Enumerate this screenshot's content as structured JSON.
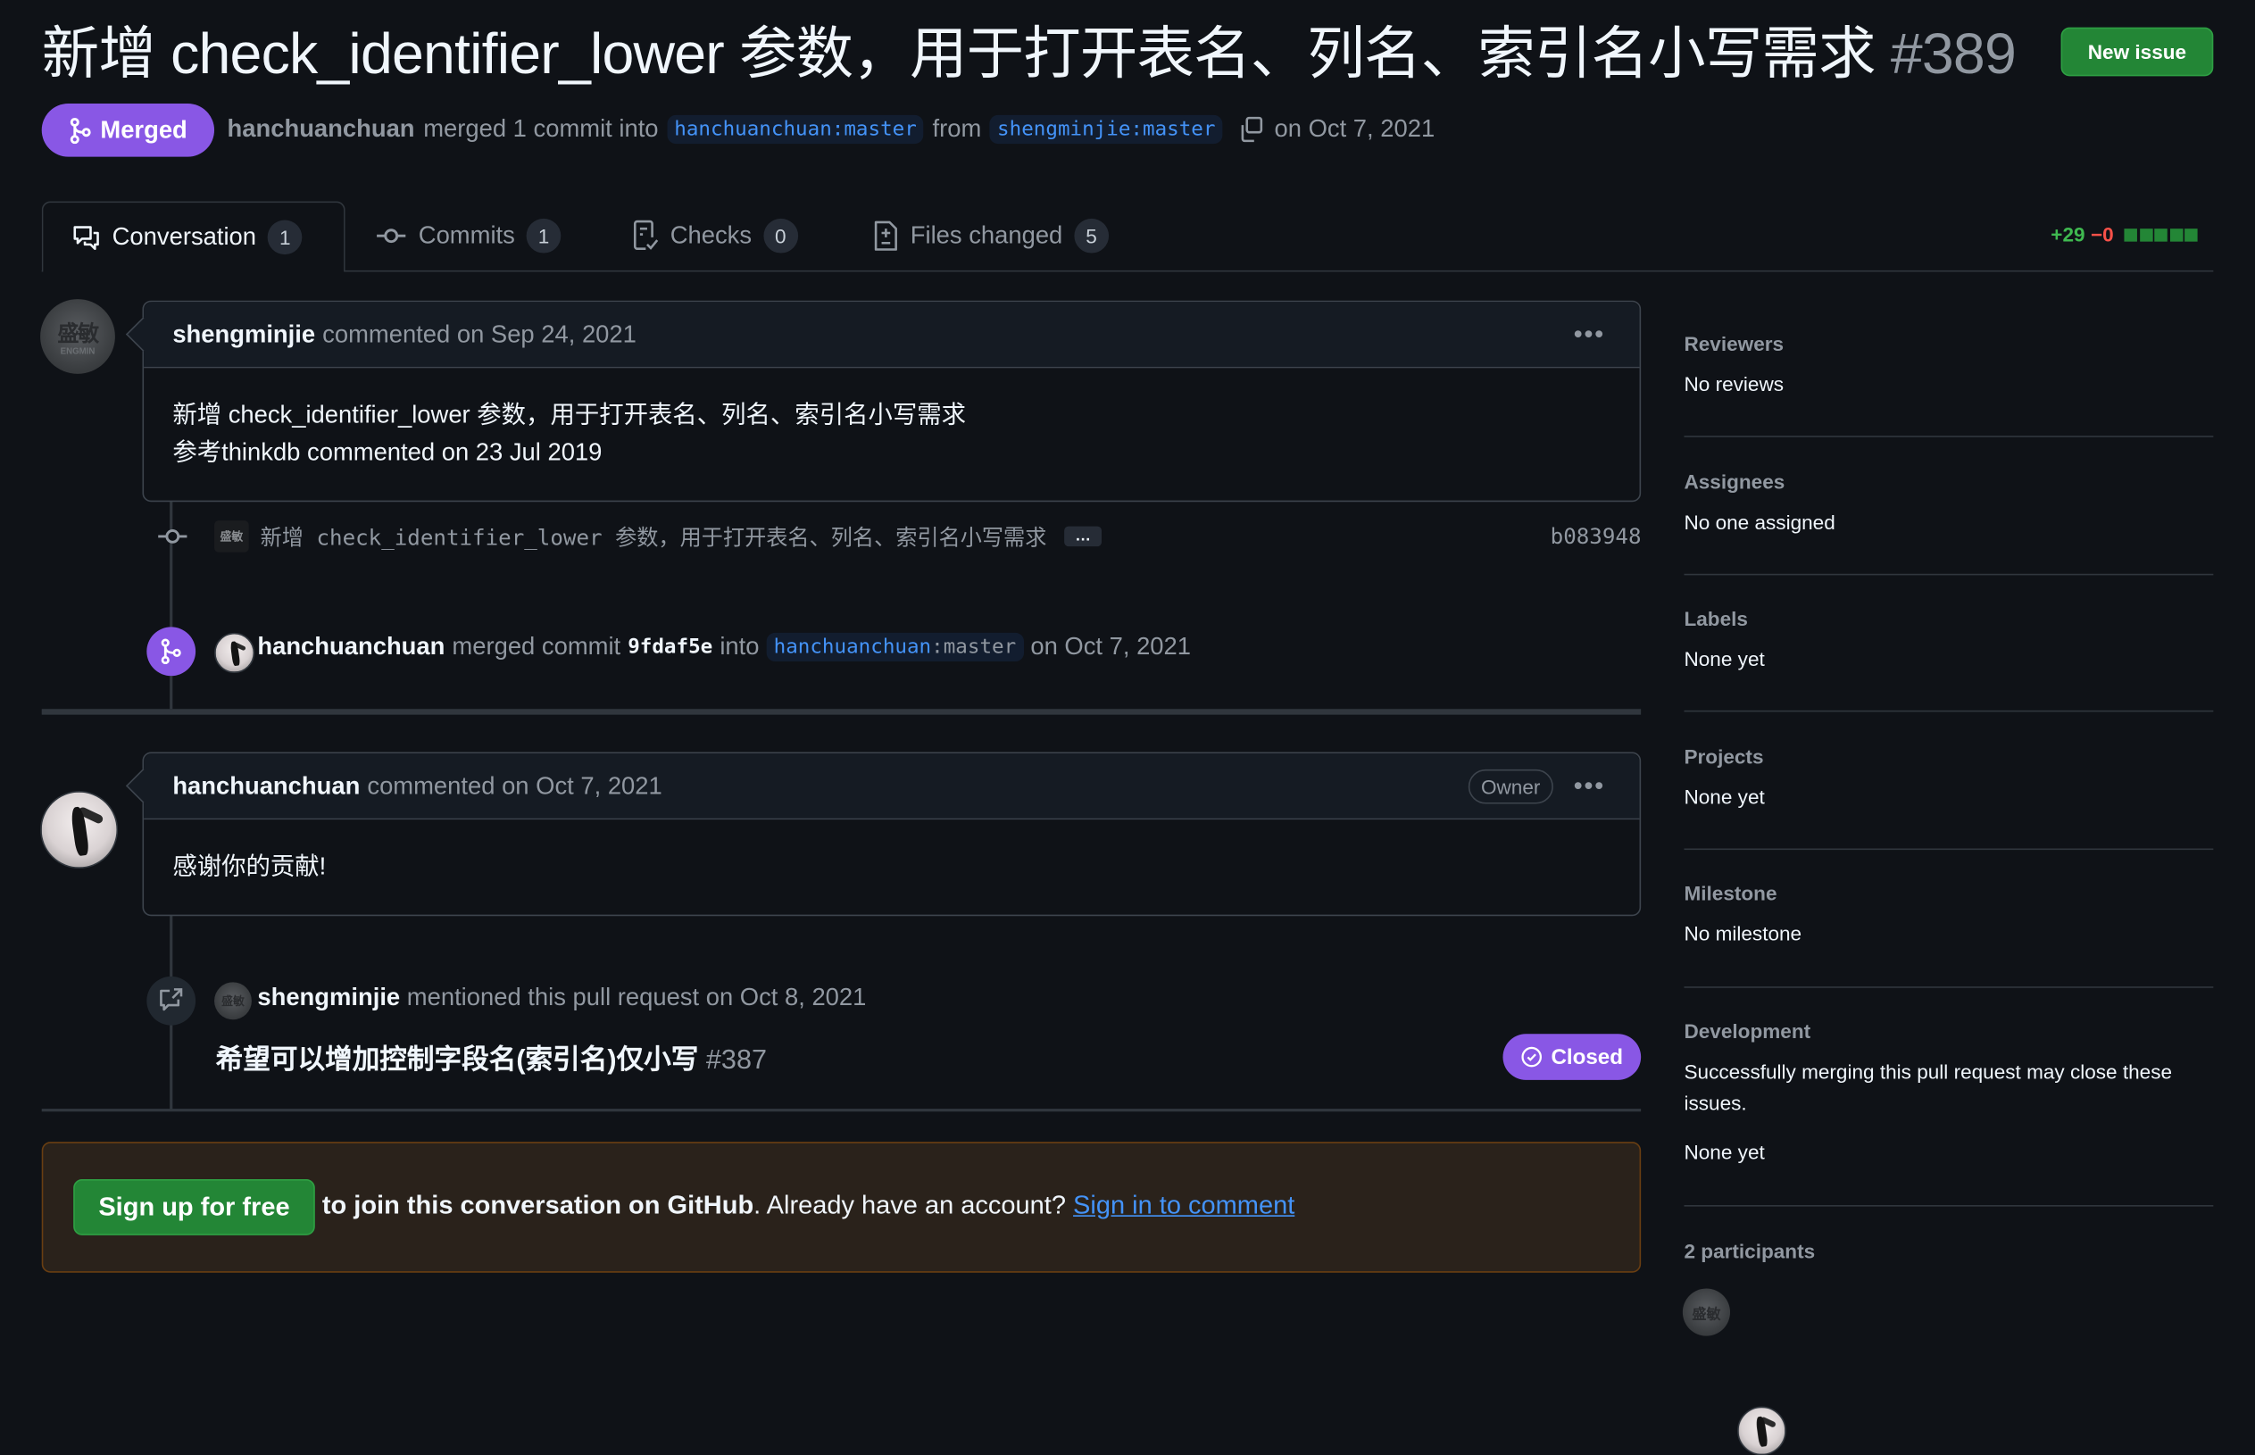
{
  "header": {
    "title": "新增 check_identifier_lower 参数，用于打开表名、列名、索引名小写需求",
    "number": "#389",
    "new_issue_label": "New issue",
    "state": "Merged",
    "meta": {
      "author": "hanchuanchuan",
      "action": "merged 1 commit into",
      "base_branch": "hanchuanchuan:master",
      "from_word": "from",
      "head_branch": "shengminjie:master",
      "date": "on Oct 7, 2021"
    }
  },
  "tabs": [
    {
      "label": "Conversation",
      "count": "1",
      "icon": "comment-discussion-icon",
      "active": true
    },
    {
      "label": "Commits",
      "count": "1",
      "icon": "git-commit-icon"
    },
    {
      "label": "Checks",
      "count": "0",
      "icon": "checklist-icon"
    },
    {
      "label": "Files changed",
      "count": "5",
      "icon": "file-diff-icon"
    }
  ],
  "diffstat": {
    "additions": "+29",
    "deletions": "−0",
    "blocks": 5,
    "colors": {
      "add": "#3fb950",
      "del": "#f85149",
      "block": "#238636"
    }
  },
  "timeline": {
    "comment1": {
      "author": "shengminjie",
      "meta": "commented on Sep 24, 2021",
      "body_line1": "新增 check_identifier_lower 参数，用于打开表名、列名、索引名小写需求",
      "body_line2": "参考thinkdb commented on 23 Jul 2019"
    },
    "commit": {
      "message": "新增 check_identifier_lower 参数，用于打开表名、列名、索引名小写需求",
      "more": "…",
      "sha": "b083948"
    },
    "merge_event": {
      "author": "hanchuanchuan",
      "action": "merged commit",
      "sha": "9fdaf5e",
      "into": "into",
      "branch_user": "hanchuanchuan",
      "branch_name": ":master",
      "date": "on Oct 7, 2021"
    },
    "comment2": {
      "author": "hanchuanchuan",
      "meta": "commented on Oct 7, 2021",
      "badge": "Owner",
      "body": "感谢你的贡献!"
    },
    "mention": {
      "author": "shengminjie",
      "meta": "mentioned this pull request on Oct 8, 2021",
      "issue_title": "希望可以增加控制字段名(索引名)仅小写",
      "issue_number": "#387",
      "state": "Closed"
    }
  },
  "signup": {
    "button": "Sign up for free",
    "text": "to join this conversation on GitHub",
    "text2": ". Already have an account? ",
    "link": "Sign in to comment"
  },
  "sidebar": {
    "sections": [
      {
        "heading": "Reviewers",
        "value": "No reviews"
      },
      {
        "heading": "Assignees",
        "value": "No one assigned"
      },
      {
        "heading": "Labels",
        "value": "None yet"
      },
      {
        "heading": "Projects",
        "value": "None yet"
      },
      {
        "heading": "Milestone",
        "value": "No milestone"
      },
      {
        "heading": "Development",
        "value": "Successfully merging this pull request may close these issues.",
        "value2": "None yet"
      }
    ],
    "participants": {
      "heading": "2 participants",
      "users": [
        "shengminjie",
        "hanchuanchuan"
      ]
    }
  },
  "colors": {
    "merged": "#8957e5",
    "primary_button": "#238636",
    "link": "#4493f8",
    "background": "#0f1217"
  }
}
